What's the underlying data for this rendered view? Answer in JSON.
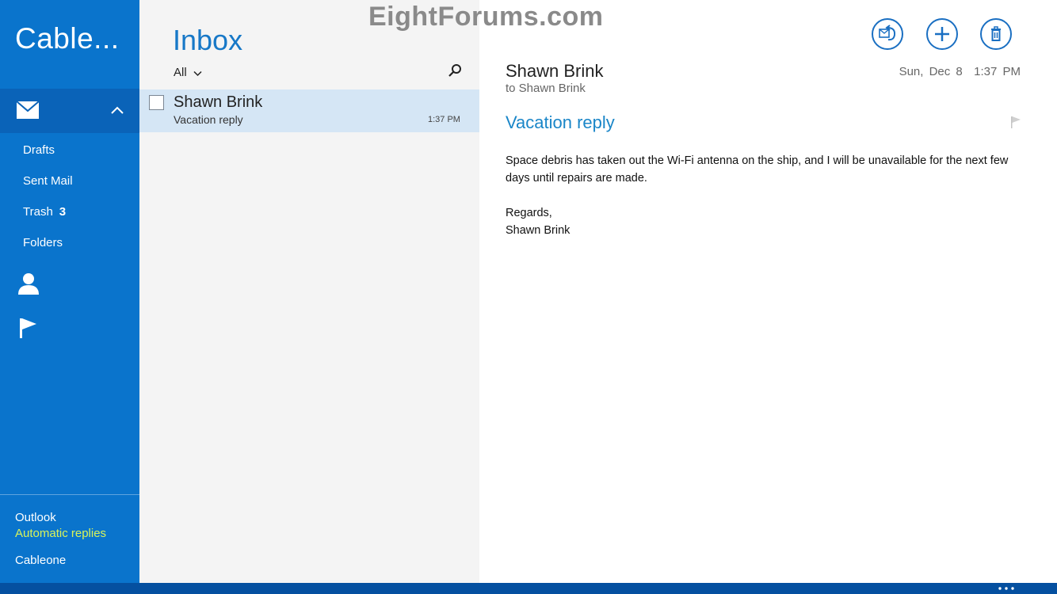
{
  "watermark": "EightForums.com",
  "sidebar": {
    "account_title": "Cable...",
    "folders": [
      {
        "label": "Drafts",
        "count": ""
      },
      {
        "label": "Sent Mail",
        "count": ""
      },
      {
        "label": "Trash",
        "count": "3"
      },
      {
        "label": "Folders",
        "count": ""
      }
    ],
    "accounts": {
      "outlook_label": "Outlook",
      "outlook_status": "Automatic replies",
      "cableone_label": "Cableone"
    },
    "icons": [
      "mail-icon",
      "chevron-up-icon",
      "people-icon",
      "flag-icon"
    ]
  },
  "list": {
    "title": "Inbox",
    "filter": "All",
    "messages": [
      {
        "sender": "Shawn Brink",
        "subject": "Vacation reply",
        "time": "1:37 PM"
      }
    ]
  },
  "reading": {
    "from": "Shawn Brink",
    "to": "to Shawn Brink",
    "date": "Sun, Dec 8",
    "time": "1:37 PM",
    "subject": "Vacation reply",
    "body": [
      "Space debris has taken out the Wi-Fi antenna on the ship, and I will be unavailable for the next few days until repairs are made.",
      "Regards,",
      "Shawn Brink"
    ],
    "actions": [
      "respond-icon",
      "new-message-icon",
      "delete-icon"
    ]
  },
  "colors": {
    "sidebar": "#0a74cc",
    "sidebar_selected": "#0a63b8",
    "accent": "#1778c7",
    "selected_row": "#d5e6f5",
    "automatic_replies": "#d8f35a",
    "bottom_bar": "#0550a0"
  }
}
